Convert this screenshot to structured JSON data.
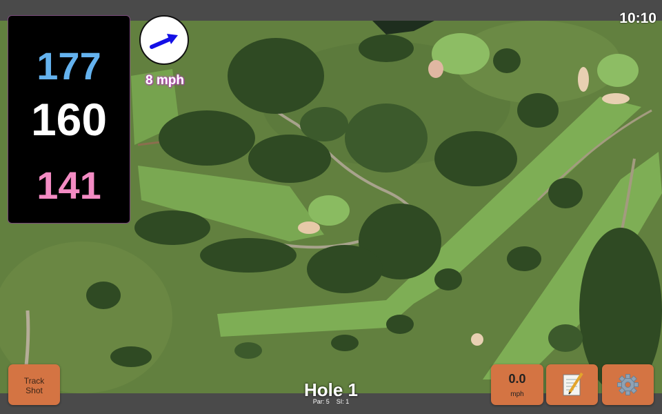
{
  "status_bar": {
    "time": "10:10"
  },
  "yardages": {
    "back": "177",
    "middle": "160",
    "front": "141"
  },
  "wind": {
    "speed": "8 mph",
    "direction_icon": "wind-arrow-icon"
  },
  "buttons": {
    "track_shot": [
      "Track",
      "Shot"
    ],
    "speed_value": "0.0",
    "speed_unit": "mph",
    "scorecard_icon": "scorecard-icon",
    "settings_icon": "gear-icon"
  },
  "hole": {
    "title": "Hole 1",
    "par": "Par: 5",
    "si": "SI: 1"
  },
  "colors": {
    "back": "#64b2ee",
    "middle": "#ffffff",
    "front": "#f38bc3",
    "button": "#d47443",
    "wind_text_glow": "#c24bc9"
  }
}
